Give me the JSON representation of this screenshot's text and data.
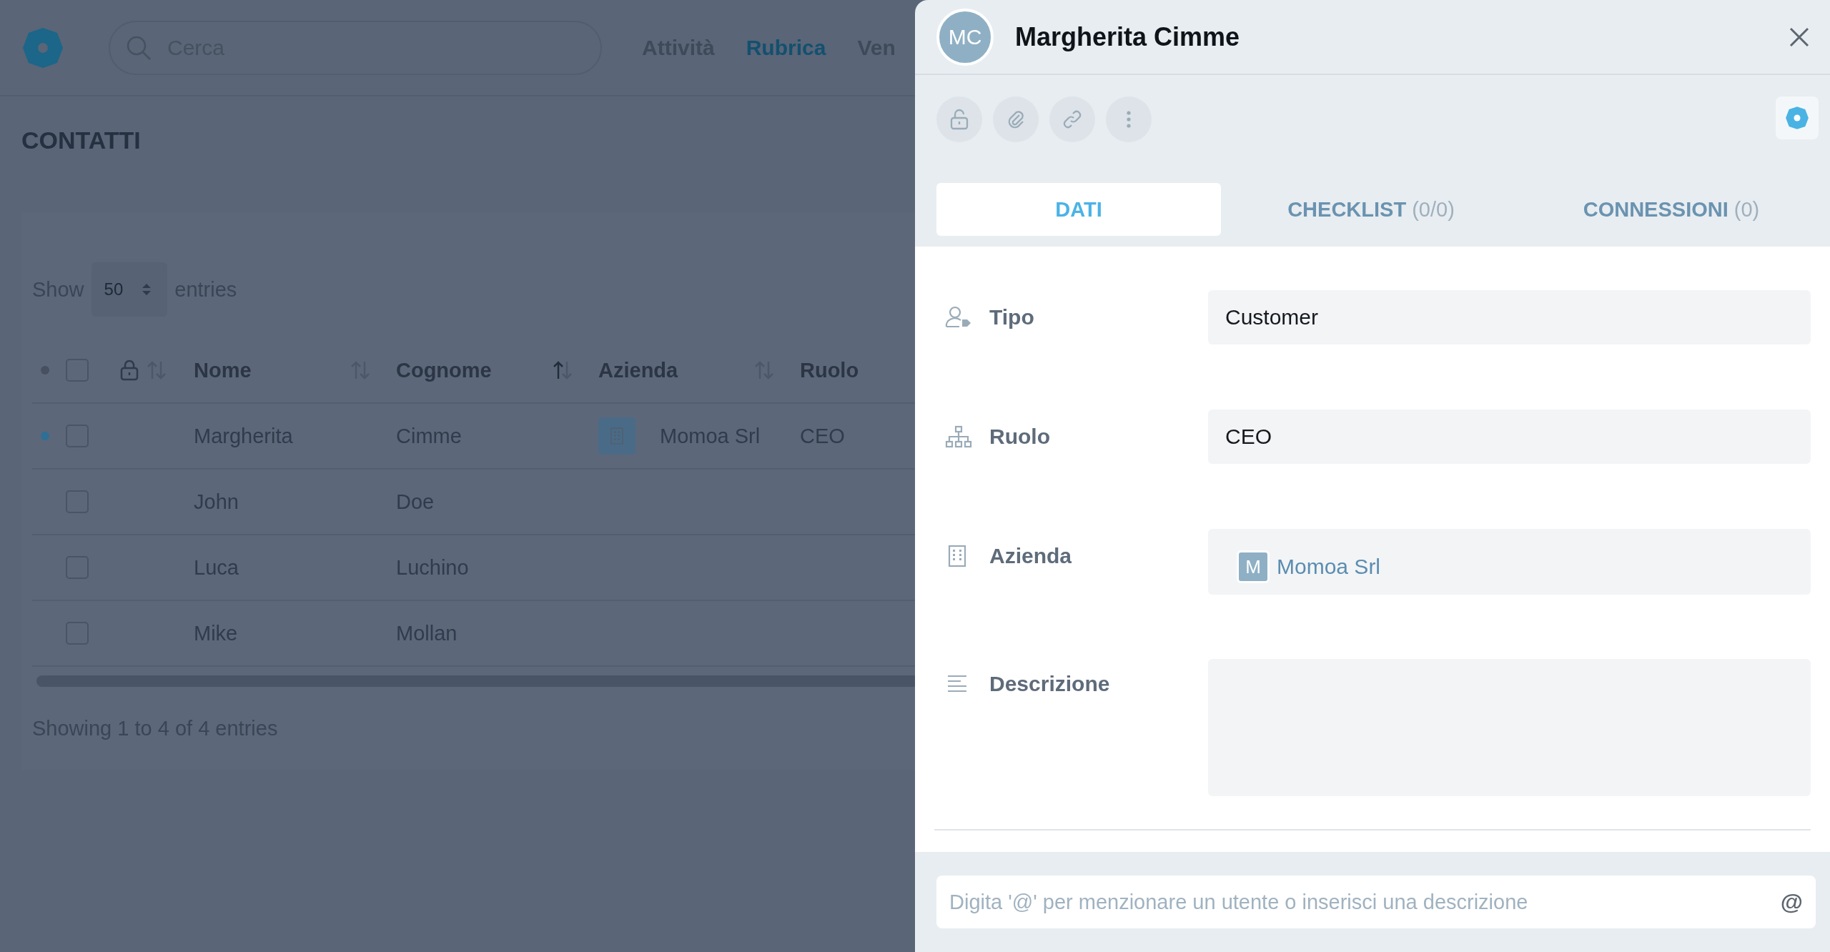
{
  "app": {
    "search": {
      "placeholder": "Cerca"
    },
    "nav": [
      {
        "label": "Attività",
        "selected": false
      },
      {
        "label": "Rubrica",
        "selected": true
      },
      {
        "label": "Ven",
        "selected": false
      }
    ]
  },
  "page": {
    "title": "CONTATTI",
    "length_menu": {
      "before": "Show",
      "value": "50",
      "after": "entries"
    },
    "table": {
      "all_checked": false,
      "columns": [
        {
          "kind": "lock",
          "sortable": true,
          "sorted": false
        },
        {
          "kind": "text",
          "label": "Nome",
          "sortable": true,
          "sorted": false
        },
        {
          "kind": "text",
          "label": "Cognome",
          "sortable": true,
          "sorted": true
        },
        {
          "kind": "text",
          "label": "Azienda",
          "sortable": true,
          "sorted": false
        },
        {
          "kind": "text",
          "label": "Ruolo"
        }
      ],
      "rows": [
        {
          "unread": true,
          "checked": false,
          "nome": "Margherita",
          "cognome": "Cimme",
          "azienda": "Momoa Srl",
          "ruolo": "CEO"
        },
        {
          "unread": false,
          "checked": false,
          "nome": "John",
          "cognome": "Doe"
        },
        {
          "unread": false,
          "checked": false,
          "nome": "Luca",
          "cognome": "Luchino"
        },
        {
          "unread": false,
          "checked": false,
          "nome": "Mike",
          "cognome": "Mollan"
        }
      ]
    },
    "info": "Showing 1 to 4 of 4 entries"
  },
  "panel": {
    "initials": "MC",
    "name": "Margherita Cimme",
    "tabs": [
      {
        "label": "DATI",
        "selected": true
      },
      {
        "label": "CHECKLIST",
        "count": "(0/0)",
        "selected": false
      },
      {
        "label": "CONNESSIONI",
        "count": "(0)",
        "selected": false
      }
    ],
    "fields": [
      {
        "kind": "text",
        "label": "Tipo",
        "value": "Customer"
      },
      {
        "kind": "text",
        "label": "Ruolo",
        "value": "CEO"
      },
      {
        "kind": "link",
        "label": "Azienda",
        "initial": "M",
        "value": "Momoa Srl"
      },
      {
        "kind": "textarea",
        "label": "Descrizione"
      }
    ],
    "comment": {
      "placeholder": "Digita '@' per menzionare un utente o inserisci una descrizione",
      "mention": "@"
    }
  }
}
